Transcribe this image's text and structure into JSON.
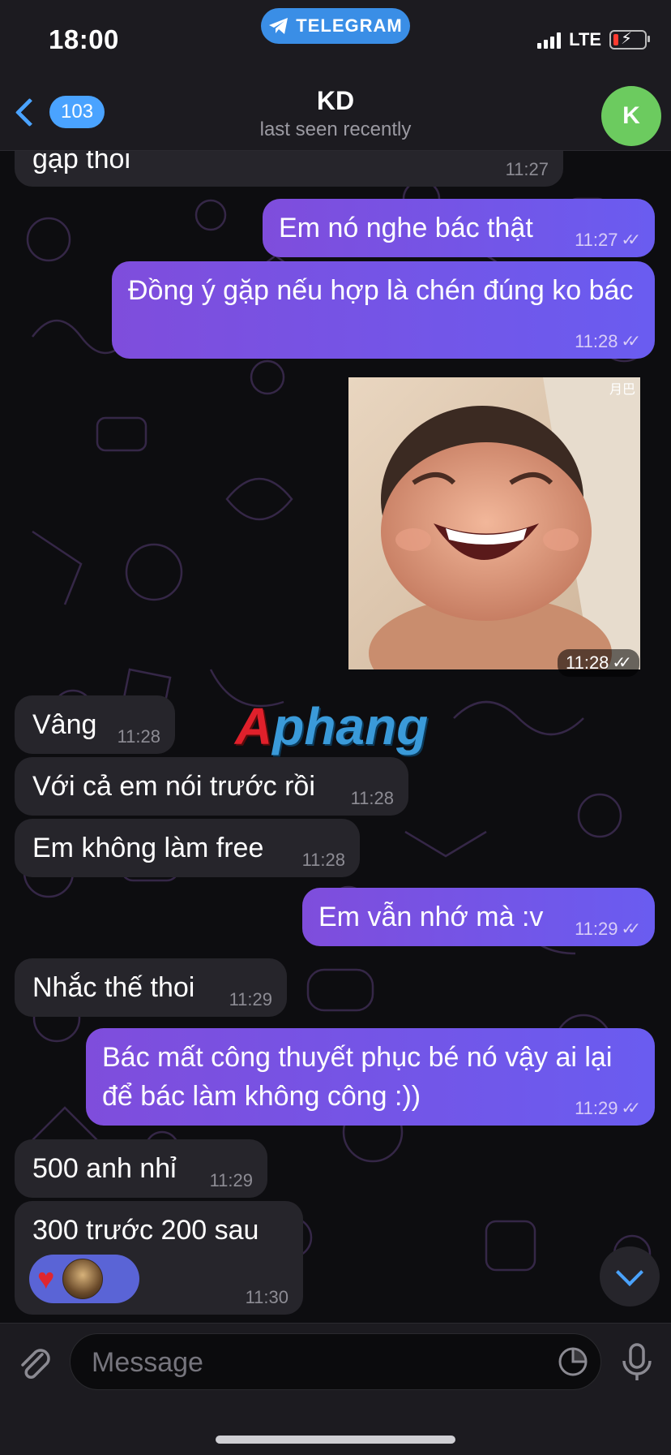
{
  "status_bar": {
    "time": "18:00",
    "app_pill": "TELEGRAM",
    "network": "LTE"
  },
  "header": {
    "back_count": "103",
    "chat_name": "KD",
    "chat_status": "last seen recently",
    "avatar_initial": "K",
    "avatar_color": "#6ccb5f"
  },
  "messages": [
    {
      "dir": "in",
      "text": "gạp thoi",
      "time": "11:27"
    },
    {
      "dir": "out",
      "text": "Em nó nghe bác thật",
      "time": "11:27"
    },
    {
      "dir": "out",
      "text": "Đồng ý gặp nếu hợp là chén đúng ko bác",
      "time": "11:28"
    },
    {
      "dir": "out",
      "type": "sticker",
      "sticker_text": "月巴",
      "time": "11:28"
    },
    {
      "dir": "in",
      "text": "Vâng",
      "time": "11:28"
    },
    {
      "dir": "in",
      "text": "Với cả em nói trước rồi",
      "time": "11:28"
    },
    {
      "dir": "in",
      "text": "Em không làm free",
      "time": "11:28"
    },
    {
      "dir": "out",
      "text": "Em vẫn nhớ mà :v",
      "time": "11:29"
    },
    {
      "dir": "in",
      "text": "Nhắc thế thoi",
      "time": "11:29"
    },
    {
      "dir": "out",
      "text": "Bác mất công thuyết phục bé nó vậy ai lại để bác làm không công :))",
      "time": "11:29"
    },
    {
      "dir": "in",
      "text": "500 anh nhỉ",
      "time": "11:29"
    },
    {
      "dir": "in",
      "text": "300 trước 200 sau",
      "time": "11:30",
      "reactions": [
        "heart-icon"
      ]
    }
  ],
  "watermark": {
    "first": "A",
    "rest": "phang"
  },
  "composer": {
    "placeholder": "Message"
  },
  "colors": {
    "accent": "#4aa3ff",
    "incoming_bubble": "#26252b",
    "outgoing_bubble_start": "#7f4ddc",
    "outgoing_bubble_end": "#6a5cf0",
    "background": "#0d0d10"
  }
}
